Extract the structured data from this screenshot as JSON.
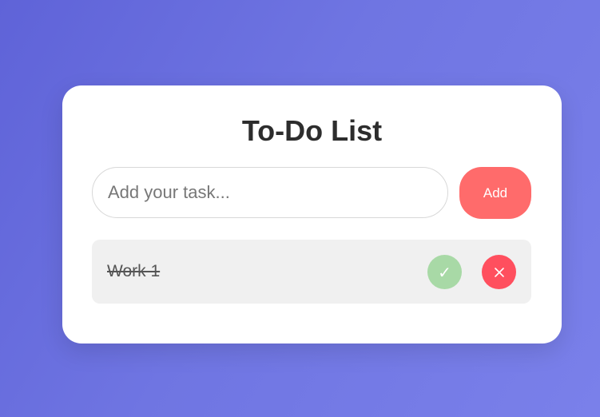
{
  "app": {
    "title": "To-Do List"
  },
  "input": {
    "placeholder": "Add your task...",
    "value": ""
  },
  "add_button": {
    "label": "Add"
  },
  "tasks": [
    {
      "text": "Work 1",
      "completed": true,
      "complete_icon": "check-icon",
      "complete_glyph": "✓",
      "delete_icon": "close-icon"
    }
  ],
  "colors": {
    "background_start": "#5f63d8",
    "background_end": "#7a80ea",
    "card": "#ffffff",
    "add_button": "#ff6b6b",
    "complete_button": "#a8d9a6",
    "delete_button": "#ff4f5e",
    "task_item": "#f0f0f0"
  }
}
